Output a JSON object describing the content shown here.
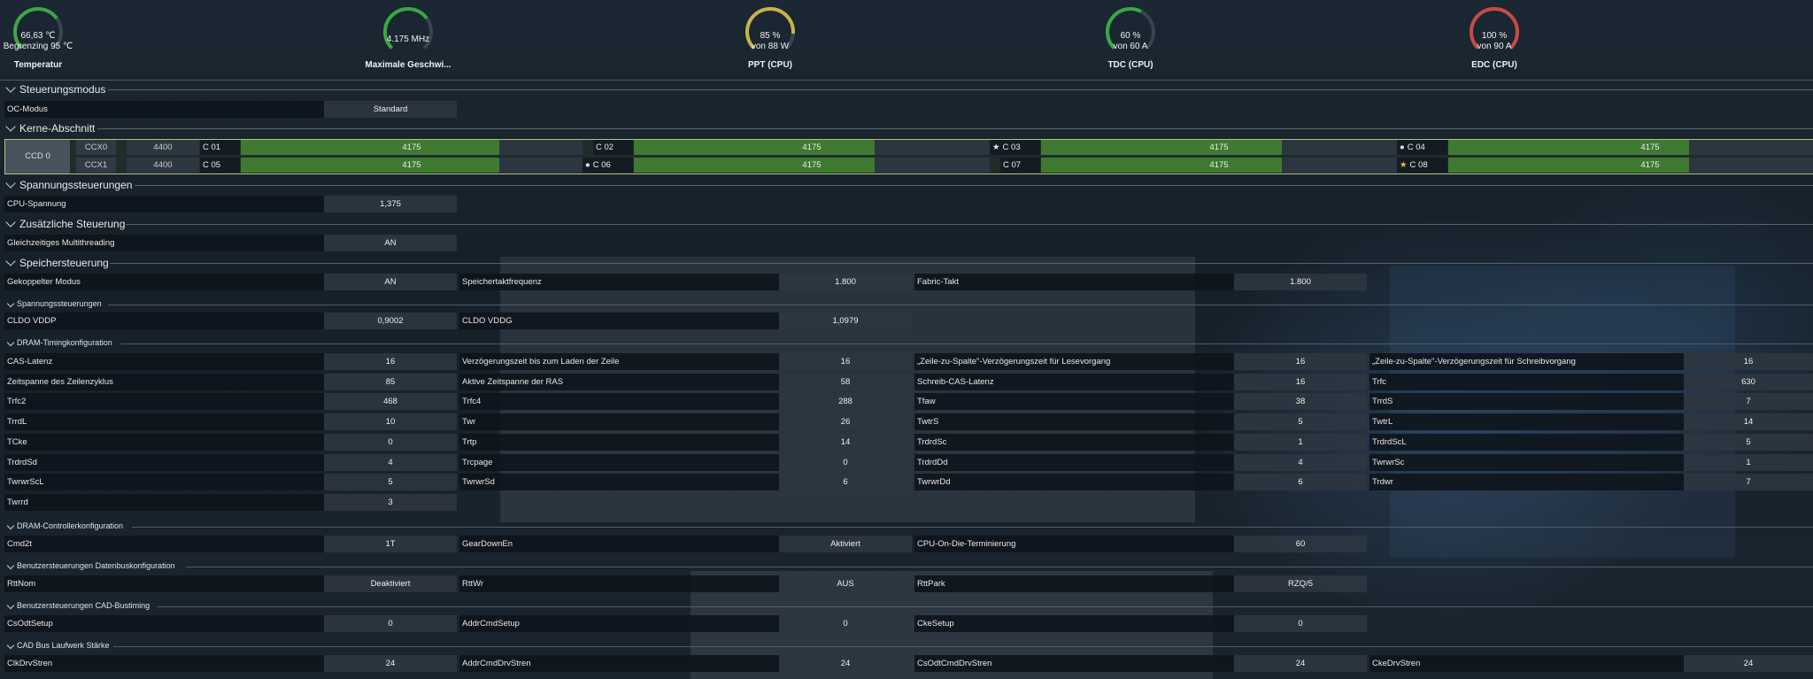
{
  "gauges": [
    {
      "line1": "66,63 ℃",
      "line2": "Begrenzing  95 ℃",
      "label": "Temperatur",
      "color": "#3aa845",
      "fraction": 0.7
    },
    {
      "line1": "4.175  MHz",
      "line2": "",
      "label": "Maximale Geschwi...",
      "color": "#3aa845",
      "fraction": 0.7
    },
    {
      "line1": "85 %",
      "line2": "von  88 W",
      "label": "PPT (CPU)",
      "color": "#c8b24a",
      "fraction": 0.85
    },
    {
      "line1": "60 %",
      "line2": "von  60 A",
      "label": "TDC (CPU)",
      "color": "#3aa845",
      "fraction": 0.6
    },
    {
      "line1": "100 %",
      "line2": "von  90 A",
      "label": "EDC (CPU)",
      "color": "#c94a43",
      "fraction": 1.0
    }
  ],
  "sections": {
    "steuerungsmodus": "Steuerungsmodus",
    "kerne": "Kerne-Abschnitt",
    "spannung": "Spannungssteuerungen",
    "zusatz": "Zusätzliche Steuerung",
    "speicher": "Speichersteuerung",
    "sub_spannung": "Spannungssteuerungen",
    "sub_dram_timing": "DRAM-Timingkonfiguration",
    "sub_dram_ctrl": "DRAM-Controllerkonfiguration",
    "sub_datenbus": "Benutzersteuerungen Datenbuskonfiguration",
    "sub_cad": "Benutzersteuerungen CAD-Bustiming",
    "sub_cad_bus": "CAD Bus Laufwerk Stärke"
  },
  "oc": {
    "label": "OC-Modus",
    "value": "Standard"
  },
  "cores": {
    "ccd": "CCD 0",
    "ccx": [
      {
        "name": "CCX0",
        "freq": "4400"
      },
      {
        "name": "CCX1",
        "freq": "4400"
      }
    ],
    "rows": [
      [
        {
          "name": "C 01",
          "value": "4175",
          "mark": ""
        },
        {
          "name": "C 02",
          "value": "4175",
          "mark": ""
        },
        {
          "name": "C 03",
          "value": "4175",
          "mark": "★"
        },
        {
          "name": "C 04",
          "value": "4175",
          "mark": "●"
        }
      ],
      [
        {
          "name": "C 05",
          "value": "4175",
          "mark": ""
        },
        {
          "name": "C 06",
          "value": "4175",
          "mark": "●"
        },
        {
          "name": "C 07",
          "value": "4175",
          "mark": ""
        },
        {
          "name": "C 08",
          "value": "4175",
          "mark": "★"
        }
      ]
    ]
  },
  "cpu_voltage": {
    "label": "CPU-Spannung",
    "value": "1,375"
  },
  "smt": {
    "label": "Gleichzeitiges Multithreading",
    "value": "AN"
  },
  "memory": [
    {
      "label": "Gekoppelter Modus",
      "value": "AN"
    },
    {
      "label": "Speichertaktfrequenz",
      "value": "1.800"
    },
    {
      "label": "Fabric-Takt",
      "value": "1.800"
    }
  ],
  "mem_voltage": [
    {
      "label": "CLDO VDDP",
      "value": "0,9002"
    },
    {
      "label": "CLDO VDDG",
      "value": "1,0979"
    }
  ],
  "dram_timing": [
    [
      {
        "label": "CAS-Latenz",
        "value": "16"
      },
      {
        "label": "Verzögerungszeit bis zum Laden der Zeile",
        "value": "16"
      },
      {
        "label": "„Zeile-zu-Spalte\"-Verzögerungszeit für Lesevorgang",
        "value": "16"
      },
      {
        "label": "„Zeile-zu-Spalte\"-Verzögerungszeit für Schreibvorgang",
        "value": "16"
      }
    ],
    [
      {
        "label": "Zeitspanne des Zeilenzyklus",
        "value": "85"
      },
      {
        "label": "Aktive Zeitspanne der RAS",
        "value": "58"
      },
      {
        "label": "Schreib-CAS-Latenz",
        "value": "16"
      },
      {
        "label": "Trfc",
        "value": "630"
      }
    ],
    [
      {
        "label": "Trfc2",
        "value": "468"
      },
      {
        "label": "Trfc4",
        "value": "288"
      },
      {
        "label": "Tfaw",
        "value": "38"
      },
      {
        "label": "TrrdS",
        "value": "7"
      }
    ],
    [
      {
        "label": "TrrdL",
        "value": "10"
      },
      {
        "label": "Twr",
        "value": "26"
      },
      {
        "label": "TwtrS",
        "value": "5"
      },
      {
        "label": "TwtrL",
        "value": "14"
      }
    ],
    [
      {
        "label": "TCke",
        "value": "0"
      },
      {
        "label": "Trtp",
        "value": "14"
      },
      {
        "label": "TrdrdSc",
        "value": "1"
      },
      {
        "label": "TrdrdScL",
        "value": "5"
      }
    ],
    [
      {
        "label": "TrdrdSd",
        "value": "4"
      },
      {
        "label": "Trcpage",
        "value": "0"
      },
      {
        "label": "TrdrdDd",
        "value": "4"
      },
      {
        "label": "TwrwrSc",
        "value": "1"
      }
    ],
    [
      {
        "label": "TwrwrScL",
        "value": "5"
      },
      {
        "label": "TwrwrSd",
        "value": "6"
      },
      {
        "label": "TwrwrDd",
        "value": "6"
      },
      {
        "label": "Trdwr",
        "value": "7"
      }
    ],
    [
      {
        "label": "Twrrd",
        "value": "3"
      }
    ]
  ],
  "dram_ctrl": [
    {
      "label": "Cmd2t",
      "value": "1T"
    },
    {
      "label": "GearDownEn",
      "value": "Aktiviert"
    },
    {
      "label": "CPU-On-Die-Terminierung",
      "value": "60"
    }
  ],
  "datenbus": [
    {
      "label": "RttNom",
      "value": "Deaktiviert"
    },
    {
      "label": "RttWr",
      "value": "AUS"
    },
    {
      "label": "RttPark",
      "value": "RZQ/5"
    }
  ],
  "cad": [
    {
      "label": "CsOdtSetup",
      "value": "0"
    },
    {
      "label": "AddrCmdSetup",
      "value": "0"
    },
    {
      "label": "CkeSetup",
      "value": "0"
    }
  ],
  "cad_bus": [
    {
      "label": "ClkDrvStren",
      "value": "24"
    },
    {
      "label": "AddrCmdDrvStren",
      "value": "24"
    },
    {
      "label": "CsOdtCmdDrvStren",
      "value": "24"
    },
    {
      "label": "CkeDrvStren",
      "value": "24"
    }
  ]
}
